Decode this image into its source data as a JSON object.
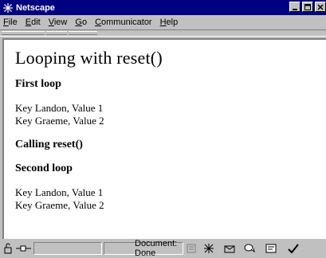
{
  "window": {
    "title": "Netscape"
  },
  "menu": {
    "items": [
      {
        "label_u": "F",
        "label_rest": "ile"
      },
      {
        "label_u": "E",
        "label_rest": "dit"
      },
      {
        "label_u": "V",
        "label_rest": "iew"
      },
      {
        "label_u": "G",
        "label_rest": "o"
      },
      {
        "label_u": "C",
        "label_rest": "ommunicator"
      },
      {
        "label_u": "H",
        "label_rest": "elp"
      }
    ]
  },
  "page": {
    "heading": "Looping with reset()",
    "section1_title": "First loop",
    "section1_entries": [
      "Key Landon, Value 1",
      "Key Graeme, Value 2"
    ],
    "section2_title": "Calling reset()",
    "section3_title": "Second loop",
    "section3_entries": [
      "Key Landon, Value 1",
      "Key Graeme, Value 2"
    ]
  },
  "status": {
    "text": "Document: Done"
  },
  "colors": {
    "titlebar": "#000080",
    "chrome": "#c0c0c0"
  }
}
